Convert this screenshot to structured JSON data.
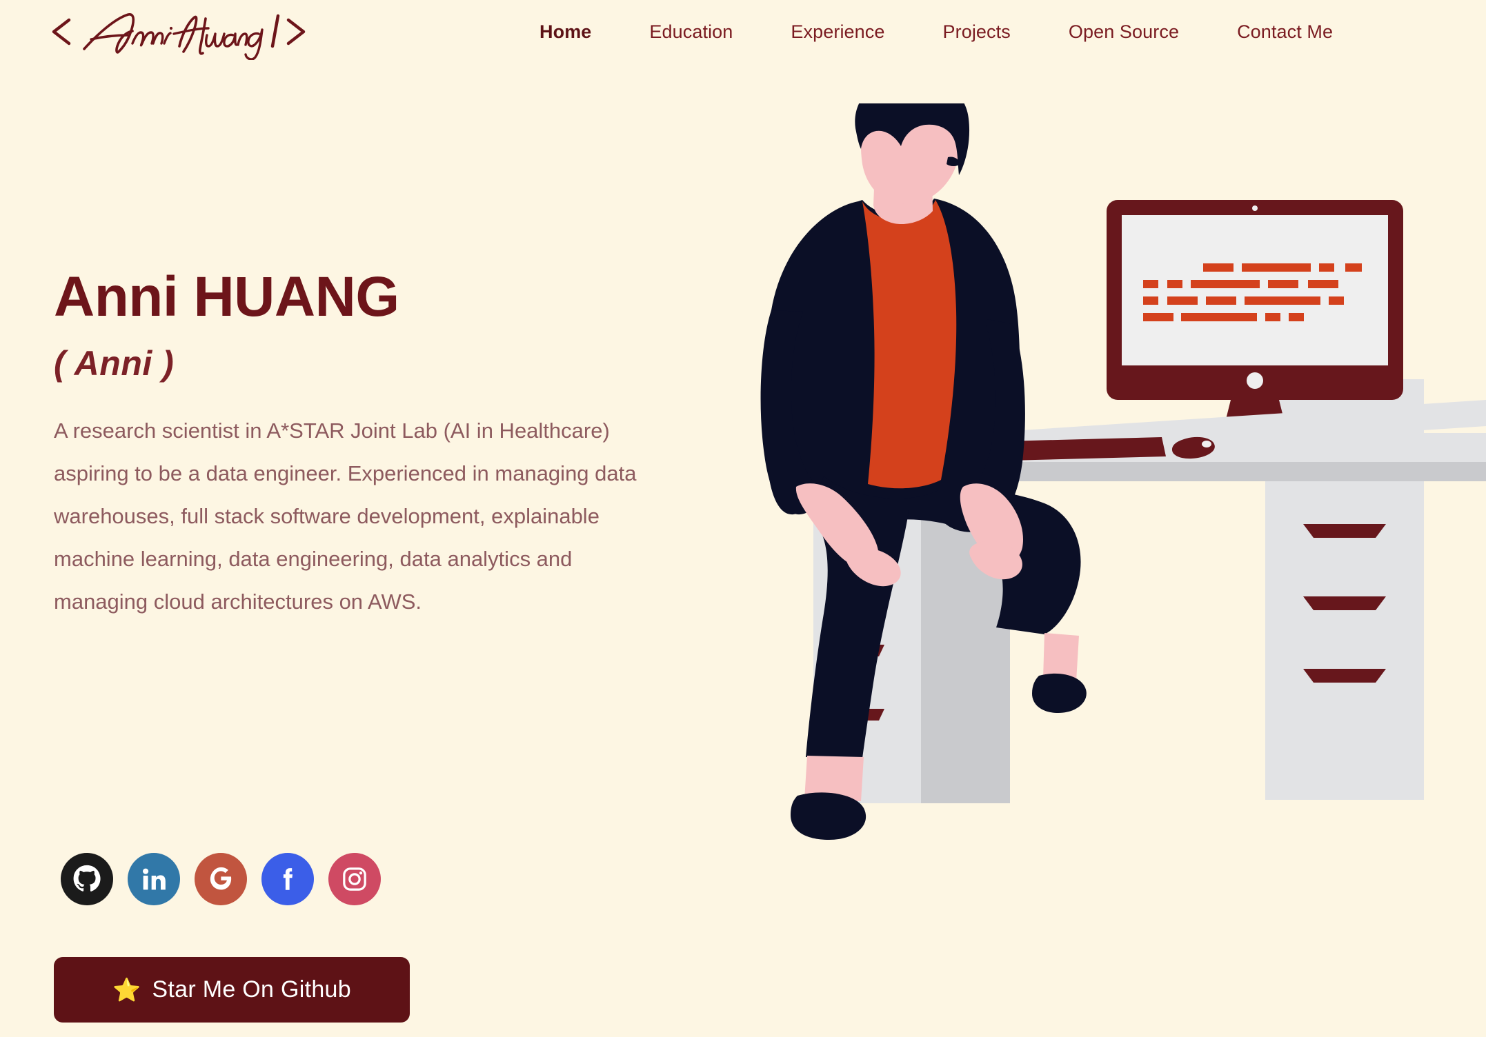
{
  "brand": {
    "prefix": "<",
    "signature": "Anni Huang",
    "suffix": "/>",
    "icon": "signature-logo"
  },
  "nav": {
    "items": [
      {
        "label": "Home",
        "active": true
      },
      {
        "label": "Education",
        "active": false
      },
      {
        "label": "Experience",
        "active": false
      },
      {
        "label": "Projects",
        "active": false
      },
      {
        "label": "Open Source",
        "active": false
      },
      {
        "label": "Contact Me",
        "active": false
      }
    ]
  },
  "hero": {
    "name": "Anni HUANG",
    "alias": "( Anni )",
    "description": "A research scientist in A*STAR Joint Lab (AI in Healthcare) aspiring to be a data engineer. Experienced in managing data warehouses, full stack software development, explainable machine learning, data engineering, data analytics and managing cloud architectures on AWS."
  },
  "socials": [
    {
      "name": "github",
      "icon": "github-icon",
      "color": "#1b1b1b"
    },
    {
      "name": "linkedin",
      "icon": "linkedin-icon",
      "color": "#3178a8"
    },
    {
      "name": "google",
      "icon": "google-icon",
      "color": "#c1553f"
    },
    {
      "name": "facebook",
      "icon": "facebook-icon",
      "color": "#3b5ee8"
    },
    {
      "name": "instagram",
      "icon": "instagram-icon",
      "color": "#cf4a63"
    }
  ],
  "cta": {
    "star_glyph": "⭐",
    "label": "Star Me On Github"
  },
  "illustration": {
    "alt": "Flat illustration of a person sitting on a drawer cabinet beside a desk with a desktop computer",
    "colors": {
      "background": "#fdf6e3",
      "dark_navy": "#0b0f26",
      "skin": "#f6bfc1",
      "shirt_orange": "#d4411c",
      "maroon": "#67171c",
      "desk_light": "#e2e3e5",
      "desk_shadow": "#c9cacd",
      "screen": "#efefef"
    }
  },
  "theme": {
    "background": "#fdf6e3",
    "accent_maroon": "#6d151a",
    "nav_text": "#7a1b21",
    "body_text": "#8d5a5e",
    "button_bg": "#5e1216"
  }
}
